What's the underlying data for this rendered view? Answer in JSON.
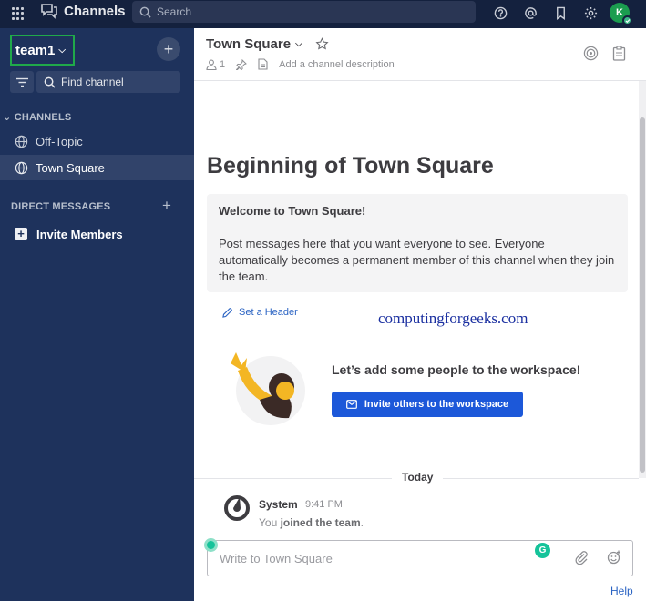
{
  "topbar": {
    "product_name": "Channels",
    "search_placeholder": "Search",
    "avatar_initial": "K"
  },
  "sidebar": {
    "team_name": "team1",
    "add_team_label": "+",
    "find_channel_placeholder": "Find channel",
    "channels_header": "CHANNELS",
    "channels": [
      {
        "label": "Off-Topic",
        "active": false
      },
      {
        "label": "Town Square",
        "active": true
      }
    ],
    "dm_header": "DIRECT MESSAGES",
    "dm_add_label": "+",
    "invite_label": "Invite Members",
    "colors": {
      "background": "#1e325c",
      "active_item": "#31436a",
      "topbar": "#14213e",
      "team_border": "#20a94a"
    }
  },
  "channel_header": {
    "title": "Town Square",
    "member_count": "1",
    "description_placeholder": "Add a channel description"
  },
  "intro": {
    "title": "Beginning of Town Square",
    "welcome_title": "Welcome to Town Square!",
    "welcome_body": "Post messages here that you want everyone to see. Everyone automatically becomes a permanent member of this channel when they join the team.",
    "set_header_label": "Set a Header",
    "watermark": "computingforgeeks.com",
    "add_people_text": "Let’s add some people to the workspace!",
    "invite_button_label": "Invite others to the workspace"
  },
  "messages": {
    "date_separator": "Today",
    "items": [
      {
        "author": "System",
        "time": "9:41 PM",
        "text_prefix": "You ",
        "text_bold": "joined the team",
        "text_suffix": "."
      }
    ]
  },
  "compose": {
    "placeholder": "Write to Town Square",
    "grammarly_glyph": "G"
  },
  "footer": {
    "help_label": "Help"
  },
  "accent_colors": {
    "primary_button": "#1c58d9",
    "link": "#2a63c3",
    "online": "#3db887"
  }
}
